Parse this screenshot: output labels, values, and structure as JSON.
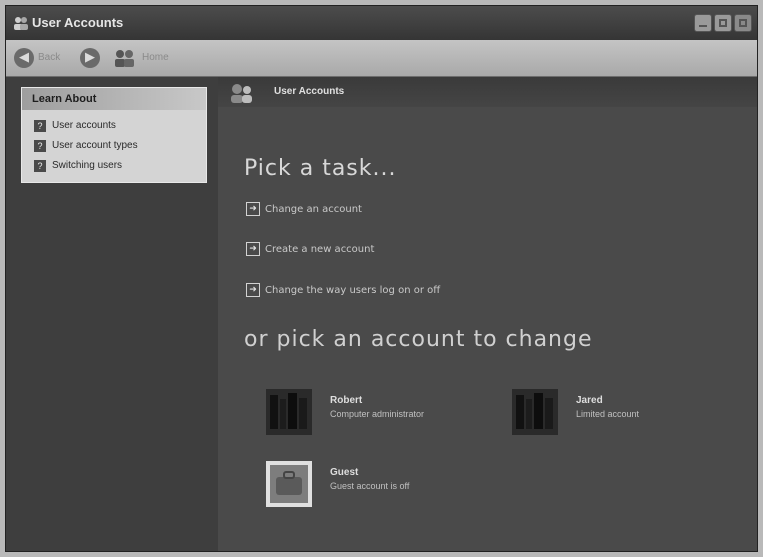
{
  "window": {
    "title": "User Accounts"
  },
  "toolbar": {
    "back_label": "Back",
    "home_label": "Home"
  },
  "sidebar": {
    "learn_title": "Learn About",
    "items": [
      {
        "label": "User accounts",
        "icon": "help-icon"
      },
      {
        "label": "User account types",
        "icon": "help-icon"
      },
      {
        "label": "Switching users",
        "icon": "help-icon"
      }
    ]
  },
  "main": {
    "header": "User Accounts",
    "pick_task": "Pick a task...",
    "tasks": [
      {
        "label": "Change an account",
        "icon": "arrow-icon"
      },
      {
        "label": "Create a new account",
        "icon": "arrow-icon"
      },
      {
        "label": "Change the way users log on or off",
        "icon": "arrow-icon"
      }
    ],
    "pick_account": "or pick an account to change",
    "accounts": [
      {
        "name": "Robert",
        "type": "Computer administrator"
      },
      {
        "name": "Jared",
        "type": "Limited account"
      },
      {
        "name": "Guest",
        "type": "Guest account is off"
      }
    ]
  },
  "colors": {
    "background": "#3b3b3b",
    "panel": "#d4d4d4",
    "text": "#d8d8d8"
  }
}
